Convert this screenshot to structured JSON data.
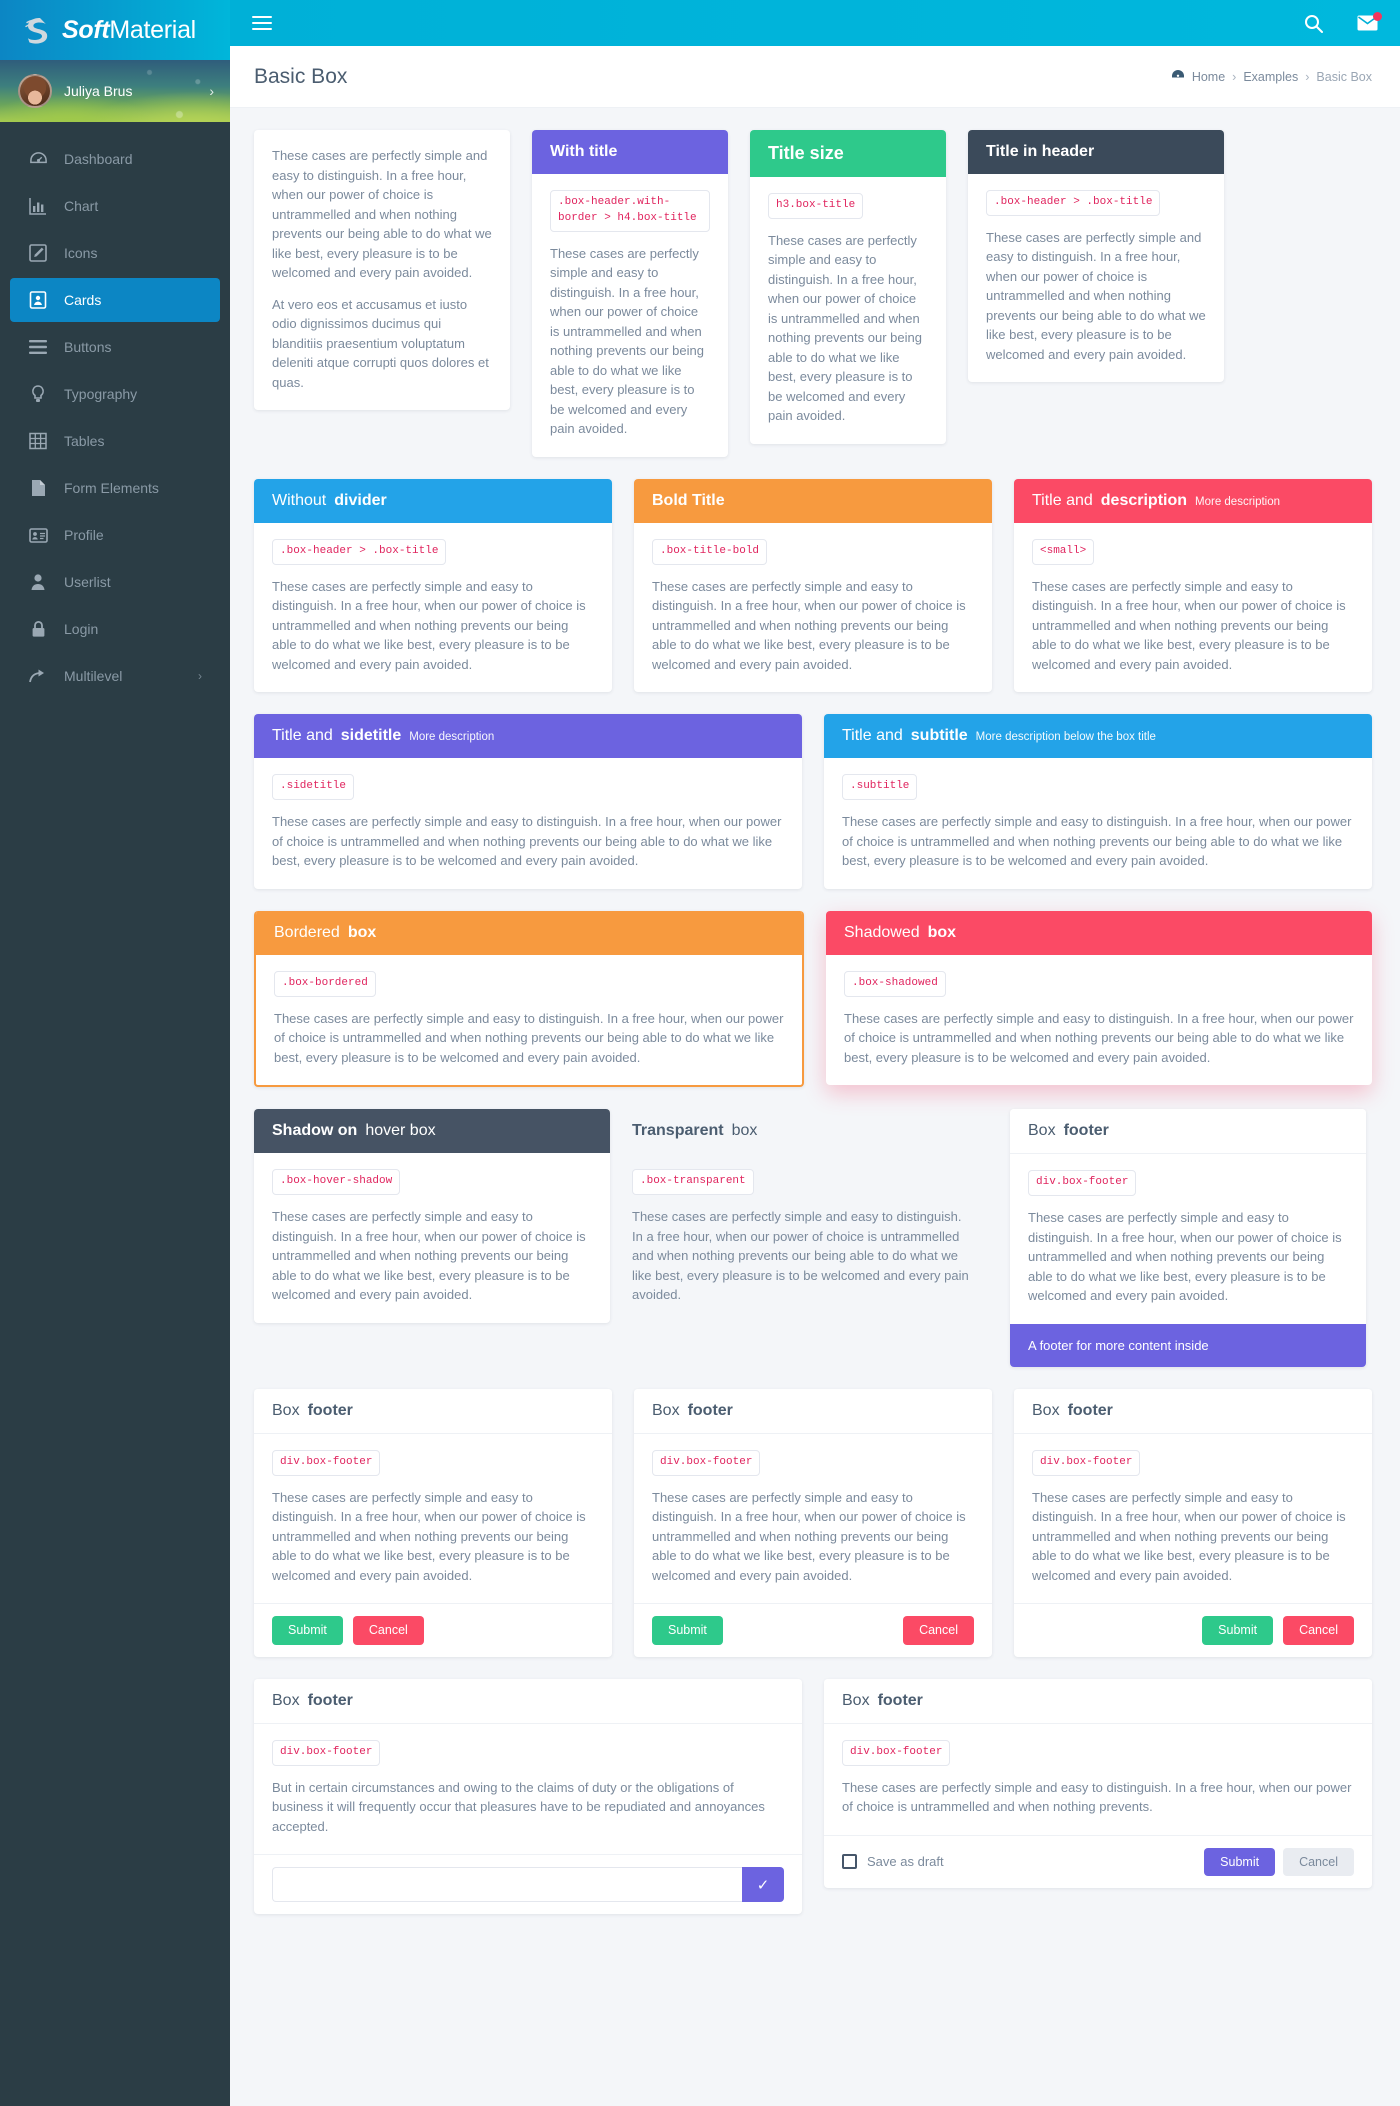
{
  "brand": {
    "bold": "Soft",
    "light": "Material"
  },
  "user": {
    "name": "Juliya Brus",
    "chevron": "›"
  },
  "topbar": {
    "menu_icon": "hamburger-icon",
    "search_icon": "search-icon",
    "mail_icon": "mail-icon"
  },
  "sidebar": {
    "items": [
      {
        "label": "Dashboard",
        "icon": "dashboard-icon",
        "active": false
      },
      {
        "label": "Chart",
        "icon": "chart-bar-icon",
        "active": false
      },
      {
        "label": "Icons",
        "icon": "edit-icon",
        "active": false
      },
      {
        "label": "Cards",
        "icon": "card-icon",
        "active": true
      },
      {
        "label": "Buttons",
        "icon": "lines-icon",
        "active": false
      },
      {
        "label": "Typography",
        "icon": "bulb-icon",
        "active": false
      },
      {
        "label": "Tables",
        "icon": "table-icon",
        "active": false
      },
      {
        "label": "Form Elements",
        "icon": "file-icon",
        "active": false
      },
      {
        "label": "Profile",
        "icon": "id-card-icon",
        "active": false
      },
      {
        "label": "Userlist",
        "icon": "user-icon",
        "active": false
      },
      {
        "label": "Login",
        "icon": "lock-icon",
        "active": false
      },
      {
        "label": "Multilevel",
        "icon": "arrow-icon",
        "active": false,
        "chevron": "›"
      }
    ]
  },
  "page": {
    "title": "Basic Box",
    "breadcrumb": {
      "home": "Home",
      "examples": "Examples",
      "current": "Basic Box",
      "sep": "›"
    }
  },
  "text": {
    "lorem": "These cases are perfectly simple and easy to distinguish. In a free hour, when our power of choice is untrammelled and when nothing prevents our being able to do what we like best, every pleasure is to be welcomed and every pain avoided.",
    "lorem2": "At vero eos et accusamus et iusto odio dignissimos ducimus qui blanditiis praesentium voluptatum deleniti atque corrupti quos dolores et quas.",
    "short": "These cases are perfectly simple and easy to distinguish. In a free hour, when our power of choice is untrammelled and when nothing prevents.",
    "duty": "But in certain circumstances and owing to the claims of duty or the obligations of business it will frequently occur that pleasures have to be repudiated and annoyances accepted."
  },
  "cards": {
    "plain": {
      "code": ""
    },
    "with_title": {
      "title": "With title",
      "code": ".box-header.with-border > h4.box-title"
    },
    "title_size": {
      "title": "Title size",
      "code": "h3.box-title"
    },
    "title_in_header": {
      "title": "Title in header",
      "code": ".box-header > .box-title"
    },
    "without_divider": {
      "title_light": "Without",
      "title_bold": "divider",
      "code": ".box-header > .box-title"
    },
    "bold_title": {
      "title": "Bold Title",
      "code": ".box-title-bold"
    },
    "title_desc": {
      "title_light": "Title and",
      "title_bold": "description",
      "desc": "More description",
      "code": "<small>"
    },
    "title_sidetitle": {
      "title_light": "Title and",
      "title_bold": "sidetitle",
      "desc": "More description",
      "code": ".sidetitle"
    },
    "title_subtitle": {
      "title_light": "Title and",
      "title_bold": "subtitle",
      "desc": "More description below the box title",
      "code": ".subtitle"
    },
    "bordered": {
      "title_light": "Bordered",
      "title_bold": "box",
      "code": ".box-bordered"
    },
    "shadowed": {
      "title_light": "Shadowed",
      "title_bold": "box",
      "code": ".box-shadowed"
    },
    "hover_shadow": {
      "title_light": "Shadow on",
      "title_bold": "hover box",
      "code": ".box-hover-shadow"
    },
    "transparent": {
      "title_light": "Transparent",
      "title_bold": "box",
      "code": ".box-transparent"
    },
    "footer_purple": {
      "title_light": "Box",
      "title_bold": "footer",
      "code": "div.box-footer",
      "footer_text": "A footer for more content inside"
    },
    "footer_a": {
      "title_light": "Box",
      "title_bold": "footer",
      "code": "div.box-footer",
      "submit": "Submit",
      "cancel": "Cancel"
    },
    "footer_b": {
      "title_light": "Box",
      "title_bold": "footer",
      "code": "div.box-footer",
      "submit": "Submit",
      "cancel": "Cancel"
    },
    "footer_c": {
      "title_light": "Box",
      "title_bold": "footer",
      "code": "div.box-footer",
      "submit": "Submit",
      "cancel": "Cancel"
    },
    "footer_input": {
      "title_light": "Box",
      "title_bold": "footer",
      "code": "div.box-footer",
      "input_value": "",
      "input_placeholder": "",
      "submit_icon": "✓"
    },
    "footer_check": {
      "title_light": "Box",
      "title_bold": "footer",
      "code": "div.box-footer",
      "check_label": "Save as draft",
      "submit": "Submit",
      "cancel": "Cancel"
    }
  },
  "colors": {
    "brand_blue": "#00b0d7",
    "sidebar_dark": "#2b3d45",
    "active_blue": "#0c86c4",
    "indigo": "#6c63e0",
    "green": "#2ec98b",
    "dark": "#3b4a5a",
    "blue": "#23a3e8",
    "orange": "#f79a3f",
    "pink": "#fb4a65",
    "slate": "#465364",
    "code_pink": "#e0245e"
  }
}
